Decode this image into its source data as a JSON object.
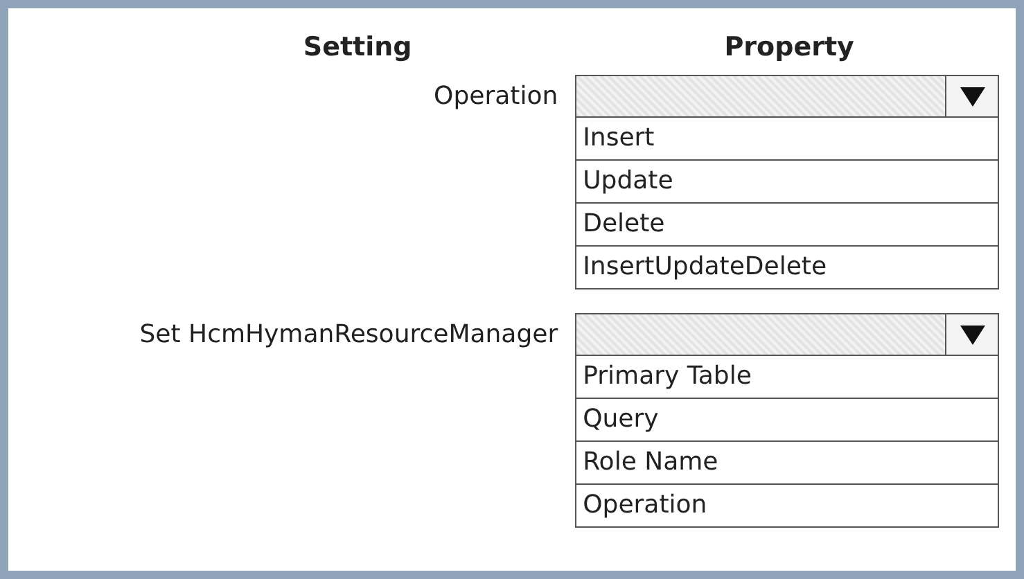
{
  "headers": [
    "Setting",
    "Property"
  ],
  "rows": [
    {
      "setting": "Operation",
      "options": [
        "Insert",
        "Update",
        "Delete",
        "InsertUpdateDelete"
      ]
    },
    {
      "setting": "Set HcmHymanResourceManager",
      "options": [
        "Primary Table",
        "Query",
        "Role Name",
        "Operation"
      ]
    }
  ]
}
